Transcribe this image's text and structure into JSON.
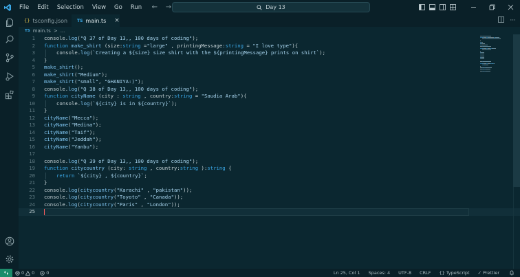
{
  "colors": {
    "keyword": "#3aa7e6",
    "function": "#7fc4f0",
    "string": "#a8d5ef",
    "punct": "#c7d4d8",
    "background": "#0b2730",
    "remote_badge": "#1c8c6a"
  },
  "menu": {
    "items": [
      "File",
      "Edit",
      "Selection",
      "View",
      "Go",
      "Run"
    ],
    "more": "···"
  },
  "command_center": {
    "text": "Day 13"
  },
  "tabs": [
    {
      "label": "tsconfig.json",
      "icon": "json-file-icon",
      "active": false
    },
    {
      "label": "main.ts",
      "icon": "typescript-file-icon",
      "active": true,
      "close": "×"
    }
  ],
  "breadcrumb": {
    "file": "main.ts",
    "sep": ">",
    "rest": "..."
  },
  "editor": {
    "current_line": 25,
    "lines": [
      {
        "n": "1",
        "t": [
          [
            "console",
            "p"
          ],
          [
            ".",
            "p"
          ],
          [
            "log",
            "f"
          ],
          [
            "(",
            "p"
          ],
          [
            "\"Q 37 of Day 13,, 100 days of coding\"",
            "s"
          ],
          [
            ");",
            "p"
          ]
        ]
      },
      {
        "n": "2",
        "t": [
          [
            "function ",
            "k"
          ],
          [
            "make_shirt ",
            "f"
          ],
          [
            "(",
            "p"
          ],
          [
            "size",
            "p"
          ],
          [
            ":",
            "p"
          ],
          [
            "string ",
            "k"
          ],
          [
            "=",
            "p"
          ],
          [
            "\"large\"",
            "s"
          ],
          [
            " , ",
            "p"
          ],
          [
            "printingMessage",
            "p"
          ],
          [
            ":",
            "p"
          ],
          [
            "string ",
            "k"
          ],
          [
            "= ",
            "p"
          ],
          [
            "\"I love type\"",
            "s"
          ],
          [
            "){",
            "p"
          ]
        ]
      },
      {
        "n": "3",
        "i": 1,
        "t": [
          [
            "console",
            "p"
          ],
          [
            ".",
            "p"
          ],
          [
            "log",
            "f"
          ],
          [
            "(",
            "p"
          ],
          [
            "`Creating a ${size} size shirt with the ${printingMessage} prints on shirt`",
            "s"
          ],
          [
            ");",
            "p"
          ]
        ]
      },
      {
        "n": "4",
        "t": [
          [
            "}",
            "p"
          ]
        ]
      },
      {
        "n": "5",
        "t": [
          [
            "make_shirt",
            "f"
          ],
          [
            "();",
            "p"
          ]
        ]
      },
      {
        "n": "6",
        "t": [
          [
            "make_shirt",
            "f"
          ],
          [
            "(",
            "p"
          ],
          [
            "\"Medium\"",
            "s"
          ],
          [
            ");",
            "p"
          ]
        ]
      },
      {
        "n": "7",
        "t": [
          [
            "make_shirt",
            "f"
          ],
          [
            "(",
            "p"
          ],
          [
            "\"small\"",
            "s"
          ],
          [
            ", ",
            "p"
          ],
          [
            "\"GHANIYA:)\"",
            "s"
          ],
          [
            ");",
            "p"
          ]
        ]
      },
      {
        "n": "8",
        "t": [
          [
            "console",
            "p"
          ],
          [
            ".",
            "p"
          ],
          [
            "log",
            "f"
          ],
          [
            "(",
            "p"
          ],
          [
            "\"Q 38 of Day 13,, 100 days of coding\"",
            "s"
          ],
          [
            ");",
            "p"
          ]
        ]
      },
      {
        "n": "9",
        "t": [
          [
            "function ",
            "k"
          ],
          [
            "cityName ",
            "f"
          ],
          [
            "(",
            "p"
          ],
          [
            "city ",
            "p"
          ],
          [
            ": ",
            "p"
          ],
          [
            "string ",
            "k"
          ],
          [
            ", ",
            "p"
          ],
          [
            "country",
            "p"
          ],
          [
            ":",
            "p"
          ],
          [
            "string ",
            "k"
          ],
          [
            "= ",
            "p"
          ],
          [
            "\"Saudia Arab\"",
            "s"
          ],
          [
            "){",
            "p"
          ]
        ]
      },
      {
        "n": "10",
        "i": 1,
        "t": [
          [
            "console",
            "p"
          ],
          [
            ".",
            "p"
          ],
          [
            "log",
            "f"
          ],
          [
            "(",
            "p"
          ],
          [
            "`${city} is in ${country}`",
            "s"
          ],
          [
            ");",
            "p"
          ]
        ]
      },
      {
        "n": "11",
        "t": [
          [
            "}",
            "p"
          ]
        ]
      },
      {
        "n": "12",
        "t": [
          [
            "cityName",
            "f"
          ],
          [
            "(",
            "p"
          ],
          [
            "\"Mecca\"",
            "s"
          ],
          [
            ");",
            "p"
          ]
        ]
      },
      {
        "n": "13",
        "t": [
          [
            "cityName",
            "f"
          ],
          [
            "(",
            "p"
          ],
          [
            "\"Medina\"",
            "s"
          ],
          [
            ");",
            "p"
          ]
        ]
      },
      {
        "n": "14",
        "t": [
          [
            "cityName",
            "f"
          ],
          [
            "(",
            "p"
          ],
          [
            "\"Taif\"",
            "s"
          ],
          [
            ");",
            "p"
          ]
        ]
      },
      {
        "n": "15",
        "t": [
          [
            "cityName",
            "f"
          ],
          [
            "(",
            "p"
          ],
          [
            "\"Jeddah\"",
            "s"
          ],
          [
            ");",
            "p"
          ]
        ]
      },
      {
        "n": "16",
        "t": [
          [
            "cityName",
            "f"
          ],
          [
            "(",
            "p"
          ],
          [
            "\"Yanbu\"",
            "s"
          ],
          [
            ");",
            "p"
          ]
        ]
      },
      {
        "n": "17",
        "t": []
      },
      {
        "n": "18",
        "t": [
          [
            "console",
            "p"
          ],
          [
            ".",
            "p"
          ],
          [
            "log",
            "f"
          ],
          [
            "(",
            "p"
          ],
          [
            "\"Q 39 of Day 13,, 100 days of coding\"",
            "s"
          ],
          [
            ");",
            "p"
          ]
        ]
      },
      {
        "n": "19",
        "t": [
          [
            "function ",
            "k"
          ],
          [
            "citycountry ",
            "f"
          ],
          [
            "(",
            "p"
          ],
          [
            "city",
            "p"
          ],
          [
            ": ",
            "p"
          ],
          [
            "string ",
            "k"
          ],
          [
            ", ",
            "p"
          ],
          [
            "country",
            "p"
          ],
          [
            ":",
            "p"
          ],
          [
            "string ",
            "k"
          ],
          [
            "):",
            "p"
          ],
          [
            "string ",
            "k"
          ],
          [
            "{",
            "p"
          ]
        ]
      },
      {
        "n": "20",
        "i": 1,
        "t": [
          [
            "return ",
            "k"
          ],
          [
            "`${city} , ${country}`",
            "s"
          ],
          [
            ";",
            "p"
          ]
        ]
      },
      {
        "n": "21",
        "t": [
          [
            "}",
            "p"
          ]
        ]
      },
      {
        "n": "22",
        "t": [
          [
            "console",
            "p"
          ],
          [
            ".",
            "p"
          ],
          [
            "log",
            "f"
          ],
          [
            "(",
            "p"
          ],
          [
            "citycountry",
            "f"
          ],
          [
            "(",
            "p"
          ],
          [
            "\"Karachi\"",
            "s"
          ],
          [
            " , ",
            "p"
          ],
          [
            "\"pakistan\"",
            "s"
          ],
          [
            "));",
            "p"
          ]
        ]
      },
      {
        "n": "23",
        "t": [
          [
            "console",
            "p"
          ],
          [
            ".",
            "p"
          ],
          [
            "log",
            "f"
          ],
          [
            "(",
            "p"
          ],
          [
            "citycountry",
            "f"
          ],
          [
            "(",
            "p"
          ],
          [
            "\"Toyoto\"",
            "s"
          ],
          [
            " , ",
            "p"
          ],
          [
            "\"Canada\"",
            "s"
          ],
          [
            "));",
            "p"
          ]
        ]
      },
      {
        "n": "24",
        "t": [
          [
            "console",
            "p"
          ],
          [
            ".",
            "p"
          ],
          [
            "log",
            "f"
          ],
          [
            "(",
            "p"
          ],
          [
            "citycountry",
            "f"
          ],
          [
            "(",
            "p"
          ],
          [
            "\"Paris\"",
            "s"
          ],
          [
            " , ",
            "p"
          ],
          [
            "\"London\"",
            "s"
          ],
          [
            "));",
            "p"
          ]
        ]
      },
      {
        "n": "25",
        "t": []
      }
    ]
  },
  "status": {
    "errors": "0",
    "warnings": "0",
    "ports": "0",
    "position": "Ln 25, Col 1",
    "spaces": "Spaces: 4",
    "encoding": "UTF-8",
    "eol": "CRLF",
    "language": "TypeScript",
    "language_braces": "{}",
    "prettier": "Prettier"
  }
}
